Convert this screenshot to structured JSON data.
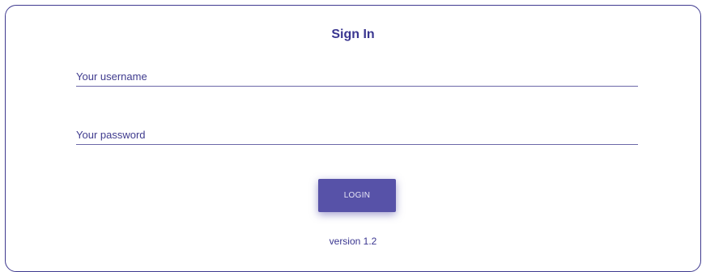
{
  "form": {
    "title": "Sign In",
    "username_placeholder": "Your username",
    "password_placeholder": "Your password",
    "login_label": "LOGIN",
    "version_text": "version 1.2"
  },
  "colors": {
    "primary": "#3a3690",
    "button": "#5752a8",
    "border": "#3f3a8f"
  }
}
